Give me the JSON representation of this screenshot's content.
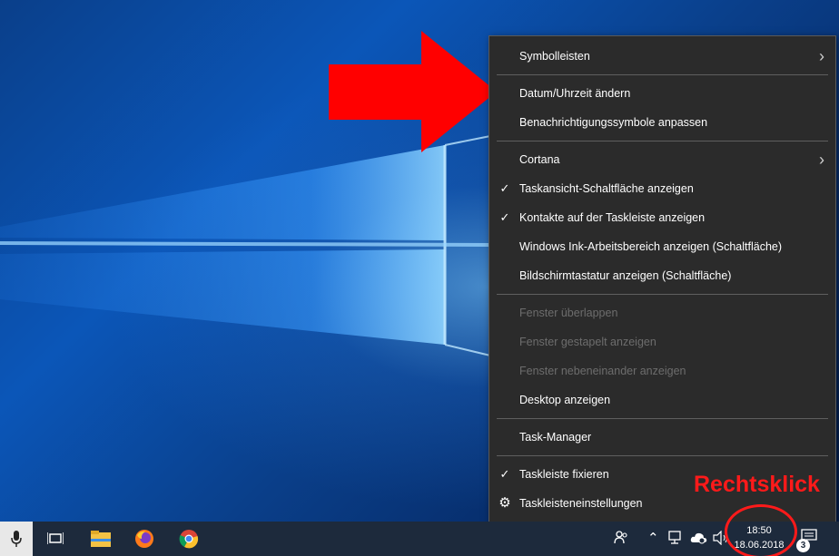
{
  "context_menu": {
    "items": [
      {
        "label": "Symbolleisten"
      },
      {
        "label": "Datum/Uhrzeit ändern"
      },
      {
        "label": "Benachrichtigungssymbole anpassen"
      },
      {
        "label": "Cortana"
      },
      {
        "label": "Taskansicht-Schaltfläche anzeigen"
      },
      {
        "label": "Kontakte auf der Taskleiste anzeigen"
      },
      {
        "label": "Windows Ink-Arbeitsbereich anzeigen (Schaltfläche)"
      },
      {
        "label": "Bildschirmtastatur anzeigen (Schaltfläche)"
      },
      {
        "label": "Fenster überlappen"
      },
      {
        "label": "Fenster gestapelt anzeigen"
      },
      {
        "label": "Fenster nebeneinander anzeigen"
      },
      {
        "label": "Desktop anzeigen"
      },
      {
        "label": "Task-Manager"
      },
      {
        "label": "Taskleiste fixieren"
      },
      {
        "label": "Taskleisteneinstellungen"
      }
    ]
  },
  "annotation": {
    "label": "Rechtsklick"
  },
  "taskbar": {
    "clock": {
      "time": "18:50",
      "date": "18.06.2018"
    },
    "notification_count": "3",
    "icons": [
      "microphone-icon",
      "task-view-icon",
      "file-explorer-icon",
      "firefox-icon",
      "chrome-icon",
      "people-icon",
      "chevron-up-icon",
      "network-icon",
      "cloud-sync-icon",
      "speaker-icon",
      "action-center-icon"
    ]
  },
  "colors": {
    "menu_bg": "#2b2b2b",
    "annotation_red": "#ff1a1a",
    "taskbar_bg": "#1d2a3c"
  }
}
